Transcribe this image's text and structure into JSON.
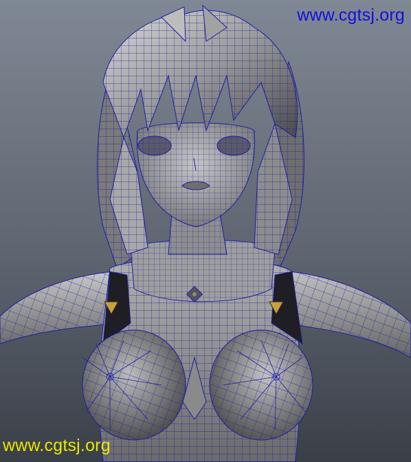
{
  "viewport": {
    "subject": "3D wireframe-on-shaded render of anime girl character model"
  },
  "watermarks": {
    "top_right": "www.cgtsj.org",
    "bottom_left": "www.cgtsj.org"
  },
  "colors": {
    "background_top": "#7c8591",
    "background_bottom": "#3b4048",
    "wireframe": "#1c1ca8",
    "watermark_top": "#1010e0",
    "watermark_bottom": "#e8e800",
    "emblem_gold": "#c8a040"
  }
}
